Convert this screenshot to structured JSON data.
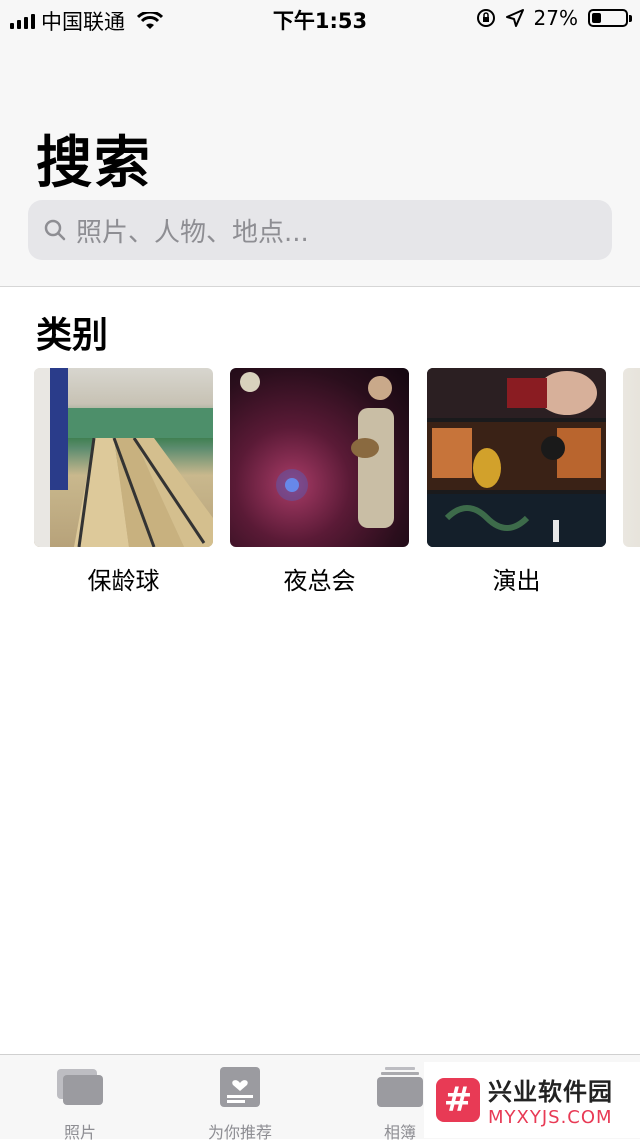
{
  "status_bar": {
    "carrier": "中国联通",
    "time": "下午1:53",
    "battery": "27%"
  },
  "header": {
    "title": "搜索",
    "search": {
      "placeholder": "照片、人物、地点..."
    }
  },
  "categories": {
    "title": "类别",
    "items": [
      {
        "label": "保龄球"
      },
      {
        "label": "夜总会"
      },
      {
        "label": "演出"
      }
    ]
  },
  "tab_bar": {
    "tabs": [
      {
        "label": "照片"
      },
      {
        "label": "为你推荐"
      },
      {
        "label": "相簿"
      }
    ]
  },
  "watermark": {
    "title": "兴业软件园",
    "url": "MYXYJS.COM"
  },
  "colors": {
    "accent": "#e83a55",
    "search_bg": "#e6e6e9",
    "placeholder": "#8e8e93"
  }
}
